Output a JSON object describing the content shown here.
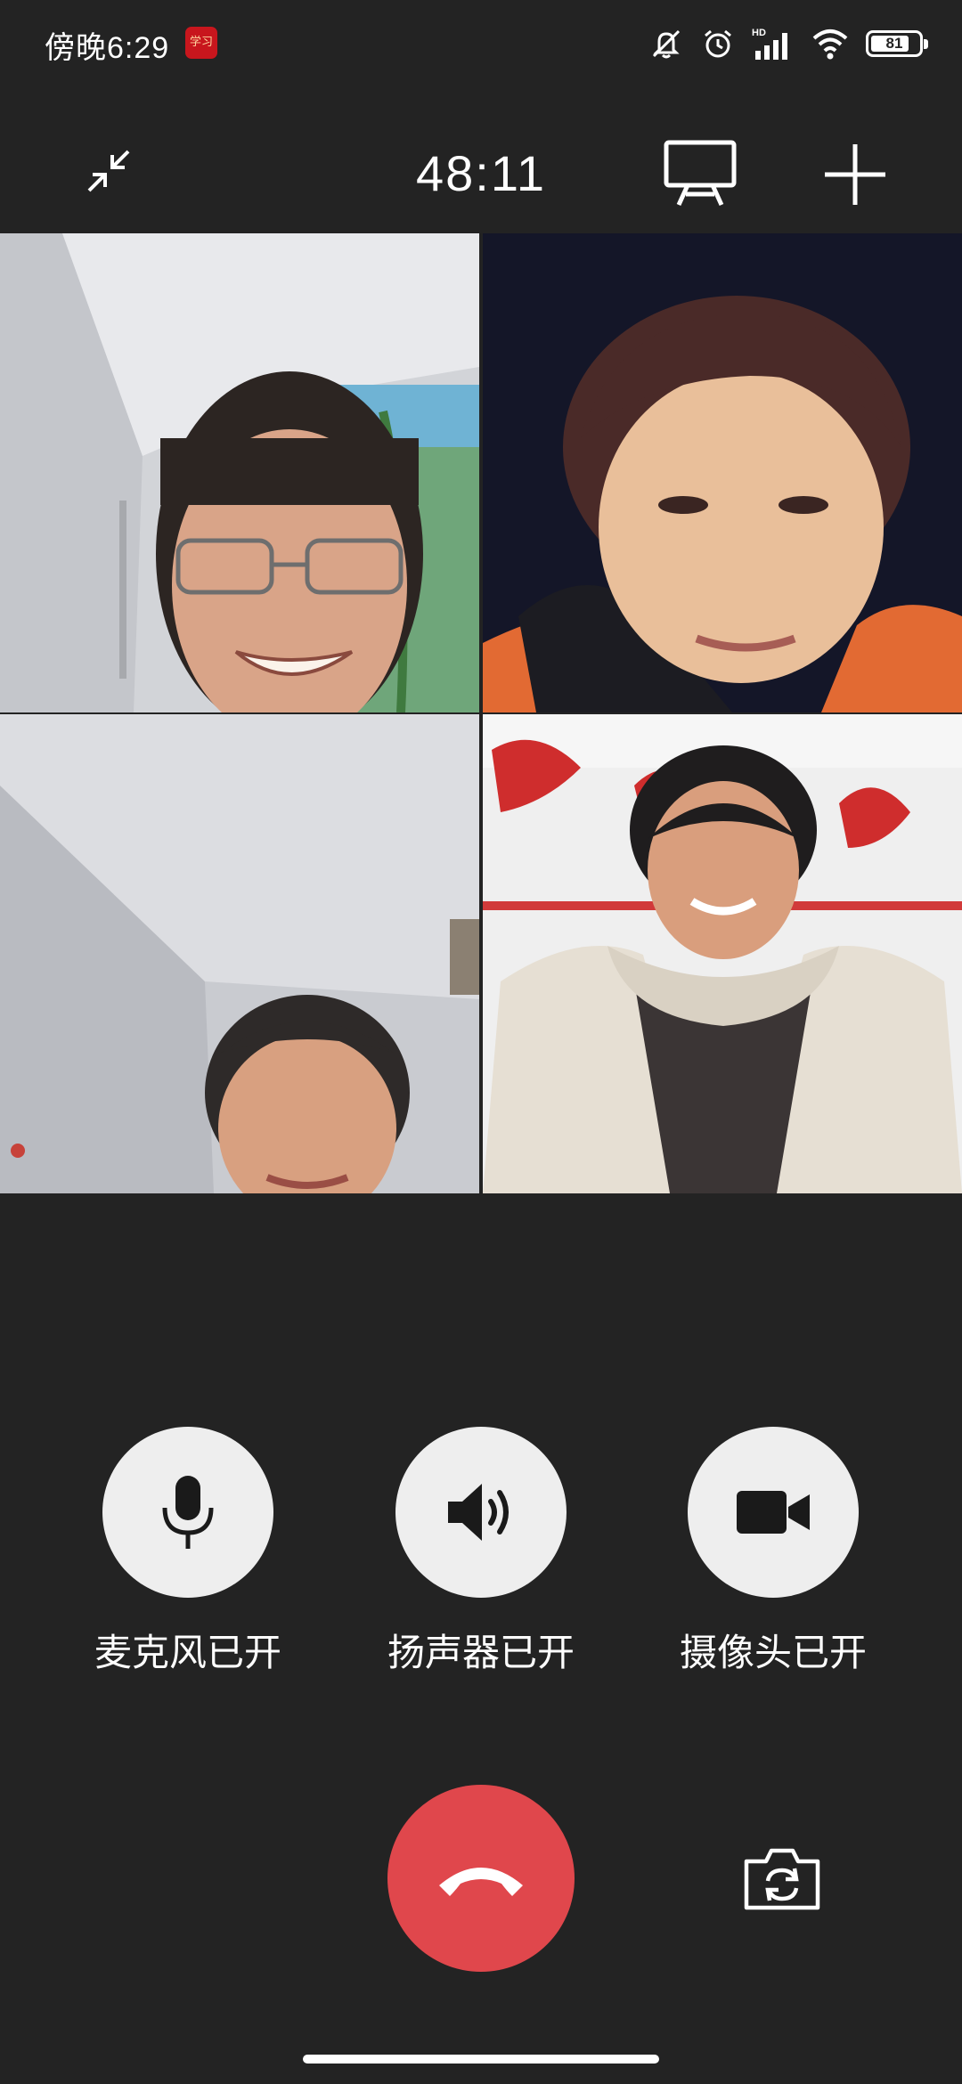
{
  "status_bar": {
    "time": "傍晚6:29",
    "app_badge_text": "学习",
    "battery_level": 81,
    "battery_text": "81",
    "network_label": "HD",
    "icons": [
      "mute-bell-icon",
      "alarm-icon",
      "signal-icon",
      "wifi-icon",
      "battery-icon"
    ]
  },
  "call": {
    "timer": "48:11",
    "top_icons": [
      "minimize-icon",
      "screen-share-icon",
      "add-participant-icon"
    ]
  },
  "participants": [
    {
      "id": 1,
      "description_icon": "video-feed"
    },
    {
      "id": 2,
      "description_icon": "video-feed"
    },
    {
      "id": 3,
      "description_icon": "video-feed"
    },
    {
      "id": 4,
      "description_icon": "video-feed"
    }
  ],
  "controls": {
    "microphone_label": "麦克风已开",
    "speaker_label": "扬声器已开",
    "camera_label": "摄像头已开"
  },
  "colors": {
    "background": "#232323",
    "control_circle": "#eeeeee",
    "hangup": "#e0474c",
    "icon_dark": "#1a1a1a"
  }
}
